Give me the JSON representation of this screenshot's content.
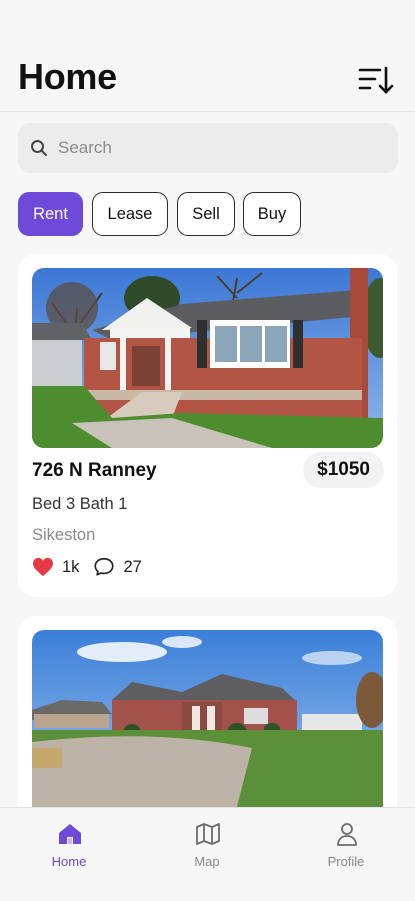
{
  "header": {
    "title": "Home",
    "sort_icon": "sort-descending-icon"
  },
  "search": {
    "placeholder": "Search",
    "value": "",
    "icon": "search-icon"
  },
  "filters": [
    {
      "label": "Rent",
      "active": true
    },
    {
      "label": "Lease",
      "active": false
    },
    {
      "label": "Sell",
      "active": false
    },
    {
      "label": "Buy",
      "active": false
    }
  ],
  "listings": [
    {
      "address": "726 N Ranney",
      "price": "$1050",
      "details": "Bed 3 Bath 1",
      "city": "Sikeston",
      "likes": "1k",
      "comments": "27",
      "photo": "red brick house with white porch"
    },
    {
      "photo": "brick house with wide driveway"
    }
  ],
  "tabbar": [
    {
      "label": "Home",
      "icon": "home-icon",
      "active": true
    },
    {
      "label": "Map",
      "icon": "map-icon",
      "active": false
    },
    {
      "label": "Profile",
      "icon": "profile-icon",
      "active": false
    }
  ],
  "colors": {
    "accent": "#6f4ad8",
    "heart": "#e53946",
    "background": "#f7f7f7"
  }
}
